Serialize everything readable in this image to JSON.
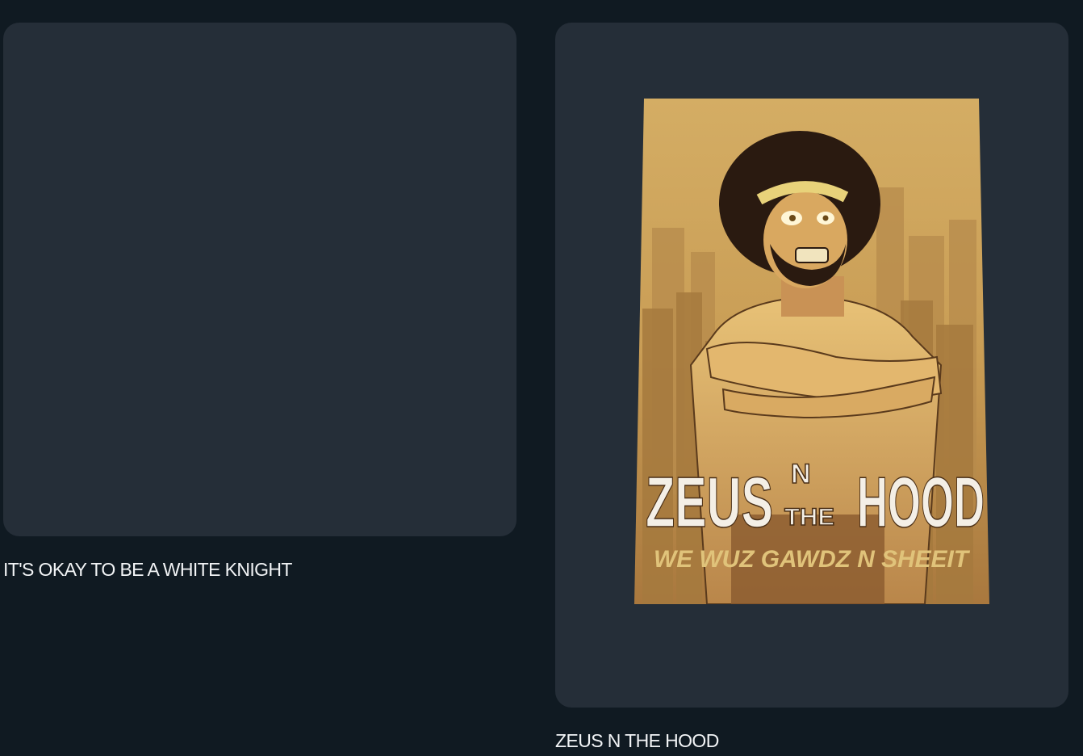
{
  "items": [
    {
      "title": "IT'S OKAY TO BE A WHITE KNIGHT",
      "has_image": false
    },
    {
      "title": "ZEUS N THE HOOD",
      "has_image": true,
      "poster": {
        "title_line_1": "ZEUS",
        "title_small": "N",
        "title_small_2": "THE",
        "title_line_2": "HOOD",
        "tagline": "WE WUZ GAWDZ N SHEEIT"
      }
    }
  ],
  "colors": {
    "page_background": "#101a22",
    "card_background": "#252e38",
    "caption_text": "#f2f4f6"
  }
}
